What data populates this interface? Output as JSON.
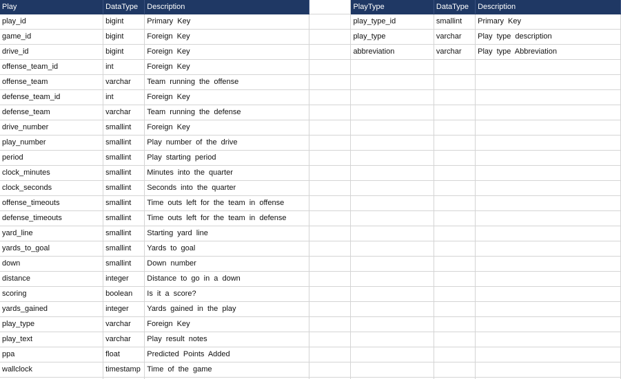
{
  "play_table": {
    "headers": [
      "Play",
      "DataType",
      "Description"
    ],
    "rows": [
      [
        "play_id",
        "bigint",
        "Primary Key"
      ],
      [
        "game_id",
        "bigint",
        "Foreign Key"
      ],
      [
        "drive_id",
        "bigint",
        "Foreign Key"
      ],
      [
        "offense_team_id",
        "int",
        "Foreign Key"
      ],
      [
        "offense_team",
        "varchar",
        "Team running the offense"
      ],
      [
        "defense_team_id",
        "int",
        "Foreign Key"
      ],
      [
        "defense_team",
        "varchar",
        "Team running the defense"
      ],
      [
        "drive_number",
        "smallint",
        "Foreign Key"
      ],
      [
        "play_number",
        "smallint",
        "Play number of the drive"
      ],
      [
        "period",
        "smallint",
        "Play starting period"
      ],
      [
        "clock_minutes",
        "smallint",
        "Minutes into the quarter"
      ],
      [
        "clock_seconds",
        "smallint",
        "Seconds into the quarter"
      ],
      [
        "offense_timeouts",
        "smallint",
        "Time outs left for the team in offense"
      ],
      [
        "defense_timeouts",
        "smallint",
        "Time outs left for the team in defense"
      ],
      [
        "yard_line",
        "smallint",
        "Starting yard line"
      ],
      [
        "yards_to_goal",
        "smallint",
        "Yards to goal"
      ],
      [
        "down",
        "smallint",
        "Down number"
      ],
      [
        "distance",
        "integer",
        "Distance to go in a down"
      ],
      [
        "scoring",
        "boolean",
        "Is it a score?"
      ],
      [
        "yards_gained",
        "integer",
        "Yards gained in the play"
      ],
      [
        "play_type",
        "varchar",
        "Foreign Key"
      ],
      [
        "play_text",
        "varchar",
        "Play result notes"
      ],
      [
        "ppa",
        "float",
        "Predicted Points Added"
      ],
      [
        "wallclock",
        "timestamp",
        "Time of the game"
      ]
    ]
  },
  "playtype_table": {
    "headers": [
      "PlayType",
      "DataType",
      "Description"
    ],
    "rows": [
      [
        "play_type_id",
        "smallint",
        "Primary Key"
      ],
      [
        "play_type",
        "varchar",
        "Play type description"
      ],
      [
        "abbreviation",
        "varchar",
        "Play type Abbreviation"
      ]
    ]
  },
  "colors": {
    "header_bg": "#1f3864",
    "header_text": "#ffffff",
    "gridline": "#d4d4d4"
  }
}
